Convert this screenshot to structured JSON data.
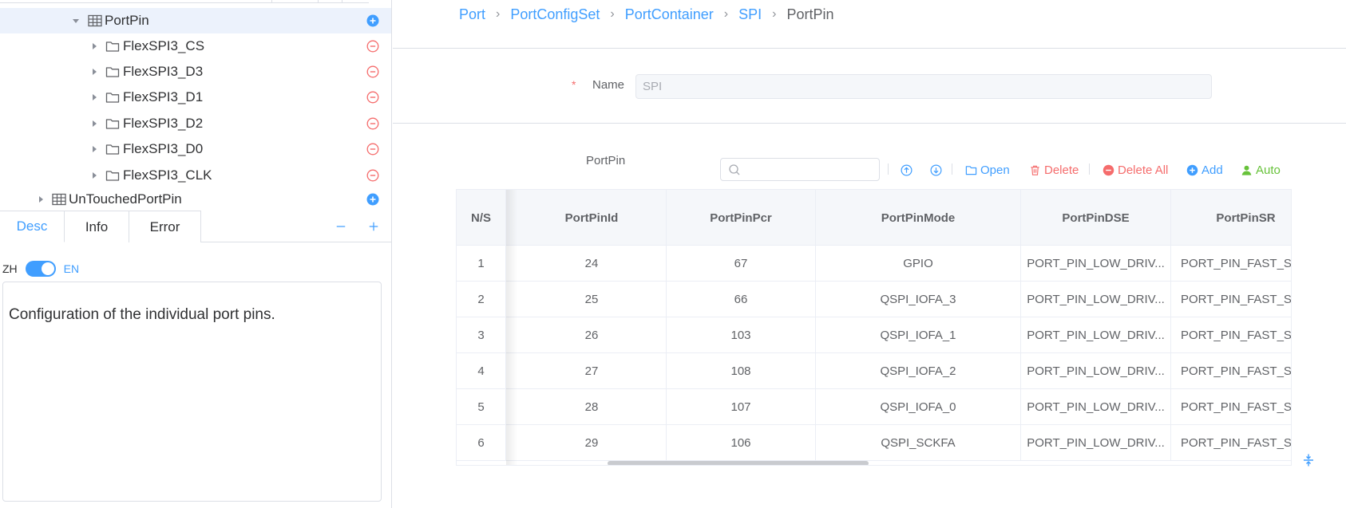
{
  "tree": {
    "items": [
      {
        "label": "PortPin",
        "icon": "table-icon",
        "expanded": true,
        "action": "add"
      },
      {
        "label": "FlexSPI3_CS",
        "icon": "folder-icon",
        "action": "remove"
      },
      {
        "label": "FlexSPI3_D3",
        "icon": "folder-icon",
        "action": "remove"
      },
      {
        "label": "FlexSPI3_D1",
        "icon": "folder-icon",
        "action": "remove"
      },
      {
        "label": "FlexSPI3_D2",
        "icon": "folder-icon",
        "action": "remove"
      },
      {
        "label": "FlexSPI3_D0",
        "icon": "folder-icon",
        "action": "remove"
      },
      {
        "label": "FlexSPI3_CLK",
        "icon": "folder-icon",
        "action": "remove"
      },
      {
        "label": "UnTouchedPortPin",
        "icon": "table-icon",
        "action": "add"
      }
    ]
  },
  "tabs": [
    {
      "label": "Desc",
      "active": true
    },
    {
      "label": "Info",
      "active": false
    },
    {
      "label": "Error",
      "active": false
    }
  ],
  "lang": {
    "zh": "ZH",
    "en": "EN",
    "selected": "EN"
  },
  "description": "Configuration of the individual port pins.",
  "breadcrumb": [
    "Port",
    "PortConfigSet",
    "PortContainer",
    "SPI",
    "PortPin"
  ],
  "form": {
    "name_label": "Name",
    "required_mark": "*",
    "name_value": "SPI"
  },
  "table_section": {
    "label": "PortPin",
    "search_value": "",
    "toolbar": {
      "open": "Open",
      "delete": "Delete",
      "delete_all": "Delete All",
      "add": "Add",
      "auto": "Auto"
    },
    "columns": [
      "N/S",
      "PortPinId",
      "PortPinPcr",
      "PortPinMode",
      "PortPinDSE",
      "PortPinSR"
    ],
    "rows": [
      [
        "1",
        "24",
        "67",
        "GPIO",
        "PORT_PIN_LOW_DRIV...",
        "PORT_PIN_FAST_SLEW"
      ],
      [
        "2",
        "25",
        "66",
        "QSPI_IOFA_3",
        "PORT_PIN_LOW_DRIV...",
        "PORT_PIN_FAST_SLEW"
      ],
      [
        "3",
        "26",
        "103",
        "QSPI_IOFA_1",
        "PORT_PIN_LOW_DRIV...",
        "PORT_PIN_FAST_SLEW"
      ],
      [
        "4",
        "27",
        "108",
        "QSPI_IOFA_2",
        "PORT_PIN_LOW_DRIV...",
        "PORT_PIN_FAST_SLEW"
      ],
      [
        "5",
        "28",
        "107",
        "QSPI_IOFA_0",
        "PORT_PIN_LOW_DRIV...",
        "PORT_PIN_FAST_SLEW"
      ],
      [
        "6",
        "29",
        "106",
        "QSPI_SCKFA",
        "PORT_PIN_LOW_DRIV...",
        "PORT_PIN_FAST_SLEW"
      ]
    ]
  },
  "colors": {
    "accent": "#409eff",
    "danger": "#f56c6c",
    "success": "#67c23a",
    "selected_row": "#ecf2fc"
  }
}
